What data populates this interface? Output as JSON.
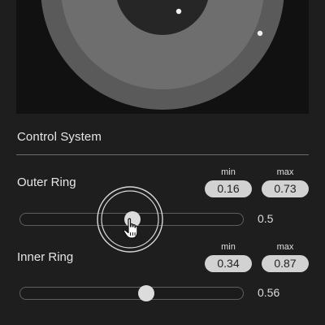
{
  "panel": {
    "title": "Control System"
  },
  "controls": {
    "outer": {
      "label": "Outer Ring",
      "min_caption": "min",
      "max_caption": "max",
      "min_value": "0.16",
      "max_value": "0.73",
      "value_text": "0.5",
      "value": 0.5
    },
    "inner": {
      "label": "Inner Ring",
      "min_caption": "min",
      "max_caption": "max",
      "min_value": "0.34",
      "max_value": "0.87",
      "value_text": "0.56",
      "value": 0.56
    }
  },
  "colors": {
    "background": "#1e1e1e",
    "viz_background": "#111111",
    "outer_ring": "#5a5a5a",
    "middle_ring": "#6e6e6e",
    "inner_disc": "#262626",
    "pill": "#d2d2d2",
    "thumb": "#dcdcdc"
  },
  "icons": {
    "cursor": "hand-pointer-icon"
  }
}
